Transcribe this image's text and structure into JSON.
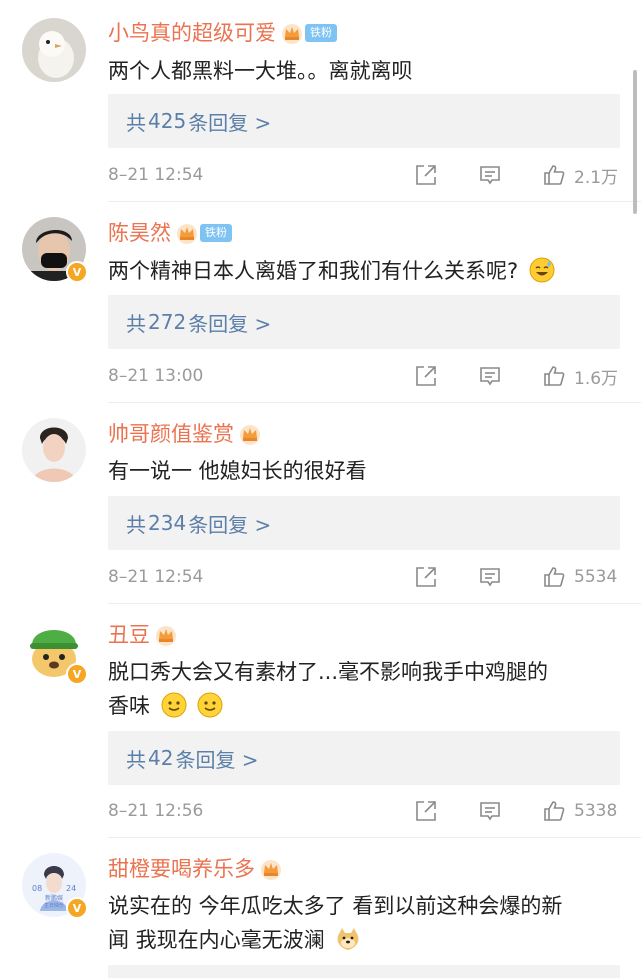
{
  "comments": [
    {
      "username": "小鸟真的超级可爱",
      "fan_badge": "铁粉",
      "text": "两个人都黑料一大堆。。离就离呗",
      "emoji": [],
      "reply": {
        "prefix": "共",
        "count": "425",
        "suffix": "条回复 >"
      },
      "time": "8–21 12:54",
      "likes": "2.1万",
      "verified": false
    },
    {
      "username": "陈昊然",
      "fan_badge": "铁粉",
      "text": "两个精神日本人离婚了和我们有什么关系呢?",
      "emoji": [
        "sweat-smile-emoji"
      ],
      "reply": {
        "prefix": "共",
        "count": "272",
        "suffix": "条回复 >"
      },
      "time": "8–21 13:00",
      "likes": "1.6万",
      "verified": true
    },
    {
      "username": "帅哥颜值鉴赏",
      "fan_badge": "",
      "text": "有一说一 他媳妇长的很好看",
      "emoji": [],
      "reply": {
        "prefix": "共",
        "count": "234",
        "suffix": "条回复 >"
      },
      "time": "8–21 12:54",
      "likes": "5534",
      "verified": false
    },
    {
      "username": "丑豆",
      "fan_badge": "",
      "text_line1": "脱口秀大会又有素材了...毫不影响我手中鸡腿的",
      "text_line2": "香味",
      "emoji": [
        "smile-emoji",
        "smile-emoji"
      ],
      "reply": {
        "prefix": "共",
        "count": "42",
        "suffix": "条回复 >"
      },
      "time": "8–21 12:56",
      "likes": "5338",
      "verified": true
    },
    {
      "username": "甜橙要喝养乐多",
      "fan_badge": "",
      "text_line1": "说实在的 今年瓜吃太多了 看到以前这种会爆的新",
      "text_line2": "闻 我现在内心毫无波澜",
      "emoji": [
        "doge-emoji"
      ],
      "avatar_text": {
        "top": "新鹏娱",
        "left": "08",
        "right": "24",
        "bottom": "生日快乐"
      },
      "verified": true
    }
  ],
  "icons": {
    "crown": "crown-icon",
    "share": "share-icon",
    "reply": "comment-icon",
    "like": "thumbs-up-icon"
  },
  "colors": {
    "username": "#eb7350",
    "reply_link": "#5b7fa8",
    "fan_badge": "#7ec3f2",
    "meta": "#9a9a9a",
    "reply_bg": "#f2f2f2"
  }
}
